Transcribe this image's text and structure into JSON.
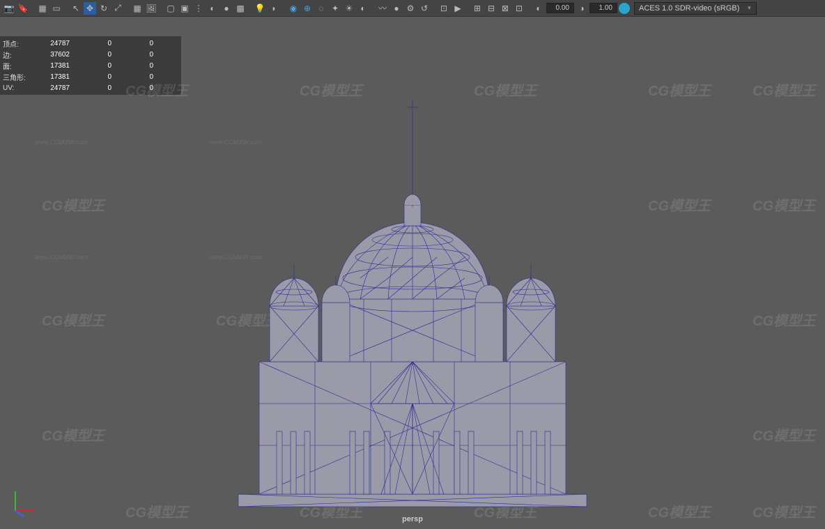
{
  "toolbar": {
    "numeric1": "0.00",
    "numeric2": "1.00",
    "colorspace": "ACES 1.0 SDR-video (sRGB)"
  },
  "stats": {
    "rows": [
      {
        "label": "顶点:",
        "v1": "24787",
        "v2": "0",
        "v3": "0"
      },
      {
        "label": "边:",
        "v1": "37602",
        "v2": "0",
        "v3": "0"
      },
      {
        "label": "面:",
        "v1": "17381",
        "v2": "0",
        "v3": "0"
      },
      {
        "label": "三角形:",
        "v1": "17381",
        "v2": "0",
        "v3": "0"
      },
      {
        "label": "UV:",
        "v1": "24787",
        "v2": "0",
        "v3": "0"
      }
    ]
  },
  "viewport": {
    "camera_label": "persp"
  },
  "watermarks": {
    "brand": "CG模型王",
    "url": "www.CGMXW.com"
  }
}
